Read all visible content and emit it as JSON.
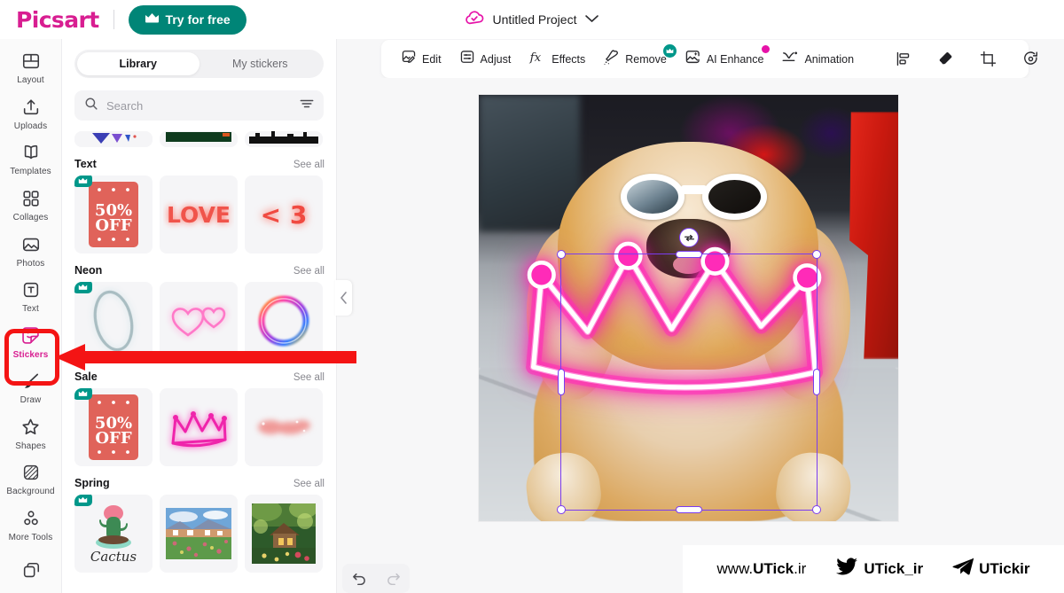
{
  "header": {
    "logo": "Picsart",
    "try_free_label": "Try for free",
    "project_title": "Untitled Project",
    "project_icon": "cloud-check-icon",
    "chevron_icon": "chevron-down-icon"
  },
  "colors": {
    "brand_pink": "#d81e91",
    "try_free_bg": "#008577",
    "badge_teal": "#00978a",
    "accent_magenta": "#e612a8",
    "selection_purple": "#7a3cf0",
    "highlight_red": "#f41414",
    "neon_pink": "#ff2bb8"
  },
  "rail": {
    "items": [
      {
        "label": "Layout",
        "icon": "layout-icon",
        "active": false
      },
      {
        "label": "Uploads",
        "icon": "upload-icon",
        "active": false
      },
      {
        "label": "Templates",
        "icon": "templates-icon",
        "active": false
      },
      {
        "label": "Collages",
        "icon": "collages-icon",
        "active": false
      },
      {
        "label": "Photos",
        "icon": "photos-icon",
        "active": false
      },
      {
        "label": "Text",
        "icon": "text-icon",
        "active": false
      },
      {
        "label": "Stickers",
        "icon": "stickers-icon",
        "active": true
      },
      {
        "label": "Draw",
        "icon": "draw-brush-icon",
        "active": false
      },
      {
        "label": "Shapes",
        "icon": "star-shape-icon",
        "active": false
      },
      {
        "label": "Background",
        "icon": "background-icon",
        "active": false
      },
      {
        "label": "More Tools",
        "icon": "more-tools-icon",
        "active": false
      }
    ]
  },
  "panel": {
    "tabs": [
      {
        "label": "Library",
        "active": true
      },
      {
        "label": "My stickers",
        "active": false
      }
    ],
    "search": {
      "placeholder": "Search",
      "value": "",
      "icon": "search-icon",
      "filter_icon": "filter-icon"
    },
    "see_all_label": "See all",
    "collapse_icon": "chevron-left-icon",
    "sections": [
      {
        "title": "",
        "partial": true,
        "tiles": [
          {
            "name": "butterfly-sticker",
            "premium": false
          },
          {
            "name": "banner-sticker",
            "premium": false
          },
          {
            "name": "skyline-sticker",
            "premium": false
          }
        ]
      },
      {
        "title": "Text",
        "partial": false,
        "tiles": [
          {
            "name": "50-percent-off-sticker",
            "label": "50%\nOFF",
            "premium": true
          },
          {
            "name": "love-neon-sticker",
            "label": "LOVE",
            "premium": false
          },
          {
            "name": "less-than-3-sticker",
            "label": "< 3",
            "premium": false
          }
        ]
      },
      {
        "title": "Neon",
        "partial": false,
        "tiles": [
          {
            "name": "neon-ring-sticker",
            "premium": true
          },
          {
            "name": "neon-heart-glasses-sticker",
            "premium": false
          },
          {
            "name": "neon-rainbow-circle-sticker",
            "premium": false
          }
        ]
      },
      {
        "title": "Sale",
        "partial": false,
        "tiles": [
          {
            "name": "50-percent-off-sale-sticker",
            "label": "50%\nOFF",
            "premium": true
          },
          {
            "name": "neon-crown-sticker",
            "premium": false
          },
          {
            "name": "pink-blur-sticker",
            "premium": false
          }
        ]
      },
      {
        "title": "Spring",
        "partial": false,
        "tiles": [
          {
            "name": "cactus-sticker",
            "label": "Cactus",
            "premium": true
          },
          {
            "name": "meadow-photo-sticker",
            "premium": false
          },
          {
            "name": "garden-cottage-sticker",
            "premium": false
          }
        ]
      }
    ]
  },
  "toolbar": {
    "tools": [
      {
        "label": "Edit",
        "icon": "edit-image-icon",
        "badge": "none"
      },
      {
        "label": "Adjust",
        "icon": "adjust-icon",
        "badge": "none"
      },
      {
        "label": "Effects",
        "icon": "fx-icon",
        "badge": "none"
      },
      {
        "label": "Remove",
        "icon": "remove-bg-icon",
        "badge": "crown"
      },
      {
        "label": "AI Enhance",
        "icon": "ai-enhance-icon",
        "badge": "dot"
      },
      {
        "label": "Animation",
        "icon": "animation-icon",
        "badge": "none"
      }
    ],
    "actions": [
      {
        "name": "align-button",
        "icon": "align-icon"
      },
      {
        "name": "eraser-button",
        "icon": "eraser-icon"
      },
      {
        "name": "crop-button",
        "icon": "crop-icon"
      },
      {
        "name": "flip-button",
        "icon": "flip-icon"
      },
      {
        "name": "duplicate-button",
        "icon": "duplicate-icon"
      },
      {
        "name": "delete-button",
        "icon": "trash-icon"
      }
    ]
  },
  "canvas": {
    "photo_description": "Chow chow dog with white sunglasses on patio",
    "selected_layer": "neon-crown-sticker",
    "rotate_icon": "rotate-icon"
  },
  "history": {
    "undo_icon": "undo-icon",
    "redo_icon": "redo-icon"
  },
  "watermark": {
    "site_prefix": "www.",
    "site_bold": "UTick",
    "site_suffix": ".ir",
    "twitter_handle": "UTick_ir",
    "telegram_handle": "UTickir",
    "twitter_icon": "twitter-bird-icon",
    "telegram_icon": "telegram-plane-icon"
  }
}
